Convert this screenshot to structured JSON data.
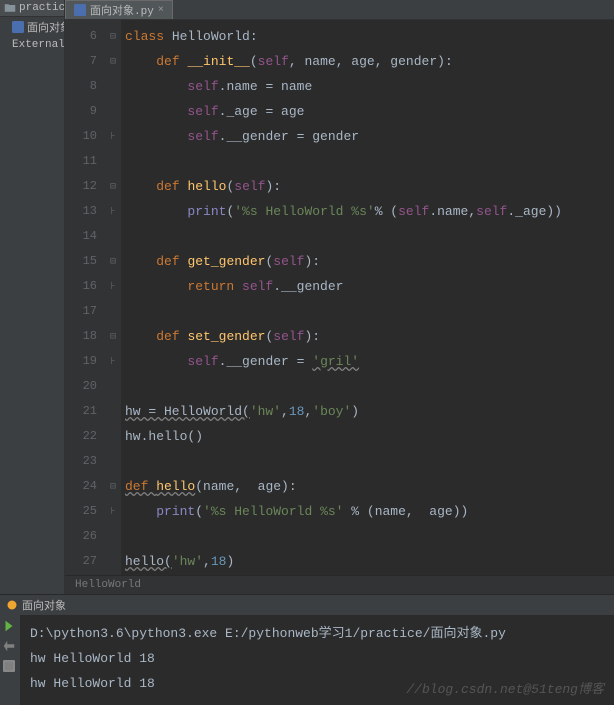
{
  "sidebar": {
    "project_name": "practice",
    "items": [
      "面向对象",
      "External Lib"
    ]
  },
  "tab": {
    "label": "面向对象.py"
  },
  "breadcrumb": "HelloWorld",
  "run_tab": "面向对象",
  "gutter": [
    "6",
    "7",
    "8",
    "9",
    "10",
    "11",
    "12",
    "13",
    "14",
    "15",
    "16",
    "17",
    "18",
    "19",
    "20",
    "21",
    "22",
    "23",
    "24",
    "25",
    "26",
    "27",
    ""
  ],
  "code": {
    "l6": {
      "kw": "class ",
      "cls": "HelloWorld",
      "colon": ":"
    },
    "l7": {
      "kw": "def ",
      "fn": "__init__",
      "p": "(",
      "self": "self",
      "args": ", name, age, gender",
      "pc": ")",
      "colon": ":"
    },
    "l8": {
      "self": "self",
      "rest": ".name = name"
    },
    "l9": {
      "self": "self",
      "rest": "._age = age"
    },
    "l10": {
      "self": "self",
      "rest": ".__gender = gender"
    },
    "l12": {
      "kw": "def ",
      "fn": "hello",
      "p": "(",
      "self": "self",
      "pc": ")",
      "colon": ":"
    },
    "l13": {
      "print": "print",
      "p": "(",
      "s": "'%s HelloWorld %s'",
      "pct": "%",
      "sp": " (",
      "self1": "self",
      "mid": ".name,",
      "self2": "self",
      "end": "._age))"
    },
    "l15": {
      "kw": "def ",
      "fn": "get_gender",
      "p": "(",
      "self": "self",
      "pc": ")",
      "colon": ":"
    },
    "l16": {
      "kw": "return ",
      "self": "self",
      "rest": ".__gender"
    },
    "l18": {
      "kw": "def ",
      "fn": "set_gender",
      "p": "(",
      "self": "self",
      "pc": ")",
      "colon": ":"
    },
    "l19": {
      "self": "self",
      "mid": ".__gender = ",
      "s": "'gril'"
    },
    "l21": {
      "a": "hw = HelloWorld(",
      "s1": "'hw'",
      "c1": ",",
      "n": "18",
      "c2": ",",
      "s2": "'boy'",
      "pc": ")"
    },
    "l22": {
      "t": "hw.hello()"
    },
    "l24": {
      "kw": "def ",
      "fn": "hello",
      "p": "(name,  age)",
      "colon": ":"
    },
    "l25": {
      "print": "print",
      "p": "(",
      "s": "'%s HelloWorld %s'",
      "rest": " % (name,  age))"
    },
    "l27": {
      "fn": "hello(",
      "s": "'hw'",
      "c": ",",
      "n": "18",
      "pc": ")"
    }
  },
  "console": {
    "cmd": "D:\\python3.6\\python3.exe  E:/pythonweb学习1/practice/面向对象.py",
    "out1": "hw HelloWorld 18",
    "out2": "hw HelloWorld 18"
  },
  "watermark": "//blog.csdn.net@51teng博客"
}
